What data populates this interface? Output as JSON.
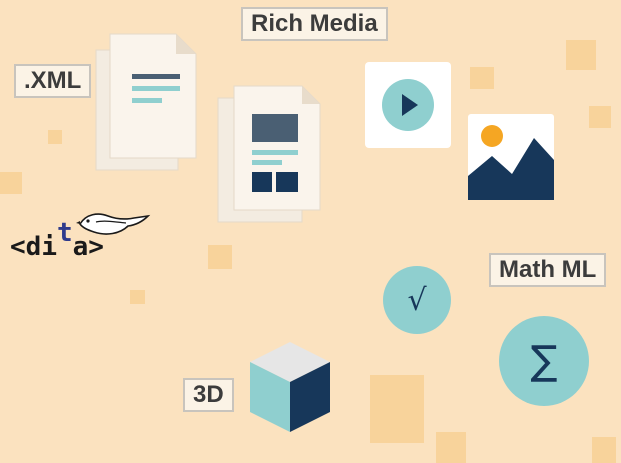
{
  "labels": {
    "rich_media": "Rich Media",
    "xml": ".XML",
    "math_ml": "Math ML",
    "three_d": "3D"
  },
  "logo": {
    "lt": "<",
    "d": "d",
    "i": "i",
    "t": "t",
    "a": "a",
    "gt": ">"
  },
  "glyphs": {
    "sqrt": "√",
    "sigma": "∑"
  },
  "colors": {
    "background": "#fbe2bf",
    "square": "#f8d39b",
    "teal": "#8fcfcf",
    "navy": "#17375a",
    "paper": "#faf4ec",
    "orange": "#f5a623"
  }
}
